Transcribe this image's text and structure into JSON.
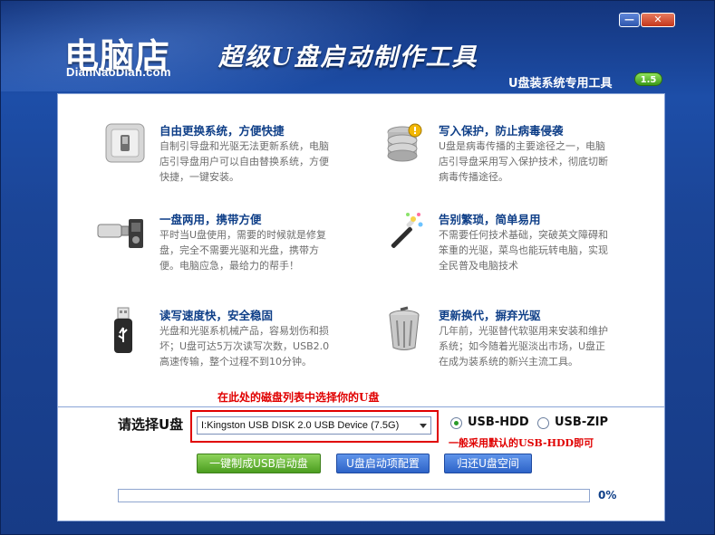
{
  "header": {
    "logo_text": "电脑店",
    "domain": "DianNaoDian.com",
    "slogan": "超级U盘启动制作工具",
    "subtitle": "U盘装系统专用工具",
    "version": "1.5",
    "minimize_label": "—",
    "close_label": "✕"
  },
  "features": [
    {
      "icon": "switch-icon",
      "title": "自由更换系统，方便快捷",
      "desc": "自制引导盘和光驱无法更新系统，电脑店引导盘用户可以自由替换系统，方便快捷，一键安装。"
    },
    {
      "icon": "database-lock-icon",
      "title": "写入保护，防止病毒侵袭",
      "desc": "U盘是病毒传播的主要途径之一，电脑店引导盘采用写入保护技术，彻底切断病毒传播途径。"
    },
    {
      "icon": "usb-device-icon",
      "title": "一盘两用，携带方便",
      "desc": "平时当U盘使用，需要的时候就是修复盘，完全不需要光驱和光盘，携带方便。电脑应急，最给力的帮手！"
    },
    {
      "icon": "magic-wand-icon",
      "title": "告别繁琐，简单易用",
      "desc": "不需要任何技术基础，突破英文障碍和笨重的光驱，菜鸟也能玩转电脑，实现全民普及电脑技术"
    },
    {
      "icon": "usb-stick-icon",
      "title": "读写速度快，安全稳固",
      "desc": "光盘和光驱系机械产品，容易划伤和损坏；U盘可达5万次读写次数，USB2.0高速传输，整个过程不到10分钟。"
    },
    {
      "icon": "trash-bin-icon",
      "title": "更新换代，摒弃光驱",
      "desc": "几年前，光驱替代软驱用来安装和维护系统；如今随着光驱淡出市场，U盘正在成为装系统的新兴主流工具。"
    }
  ],
  "panel": {
    "hint_top": "在此处的磁盘列表中选择你的U盘",
    "select_label": "请选择U盘",
    "drive_value": "I:Kingston USB DISK 2.0 USB Device (7.5G)",
    "radio_hdd": "USB-HDD",
    "radio_zip": "USB-ZIP",
    "selected_mode": "USB-HDD",
    "hint_right": "一般采用默认的USB-HDD即可",
    "btn_make": "一键制成USB启动盘",
    "btn_config": "U盘启动项配置",
    "btn_restore": "归还U盘空间",
    "progress_percent": 0,
    "progress_text": "0%"
  },
  "colors": {
    "accent_blue": "#1b4597",
    "hint_red": "#e00000",
    "title_blue": "#0f3f88",
    "button_green": "#4b9d20"
  }
}
